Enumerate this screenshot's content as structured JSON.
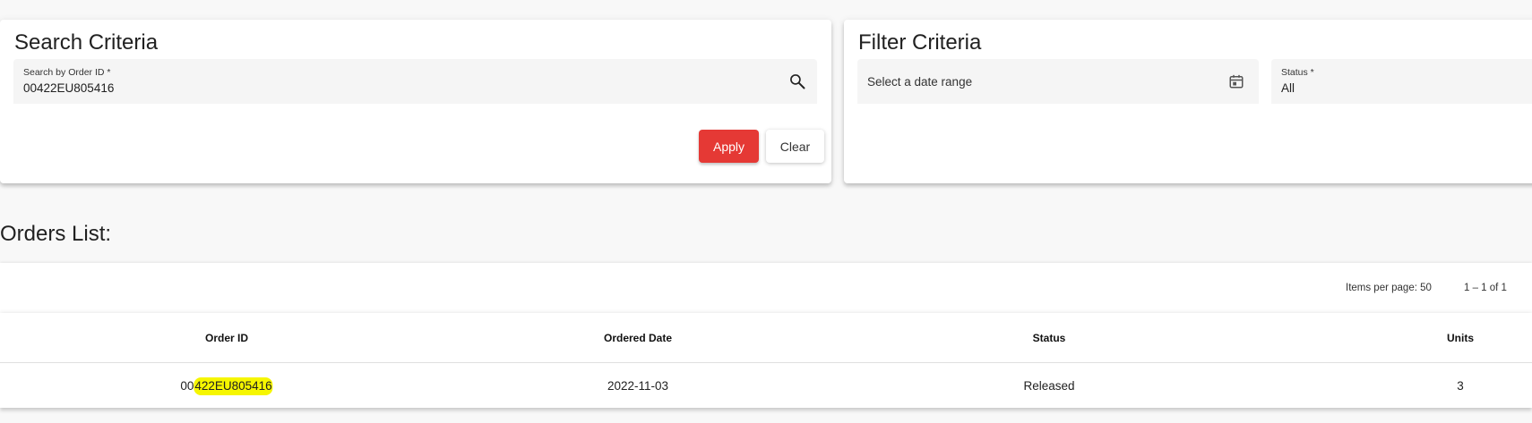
{
  "search": {
    "title": "Search Criteria",
    "field_label": "Search by Order ID *",
    "field_value": "00422EU805416",
    "apply_label": "Apply",
    "clear_label": "Clear",
    "search_icon": "search-icon"
  },
  "filter": {
    "title": "Filter Criteria",
    "date_placeholder": "Select a date range",
    "date_icon": "calendar-icon",
    "status_label": "Status *",
    "status_value": "All"
  },
  "orders": {
    "heading": "Orders List:",
    "paginator": {
      "items_per_page_label": "Items per page: 50",
      "range_label": "1 – 1 of 1"
    },
    "columns": [
      "Order ID",
      "Ordered Date",
      "Status",
      "Units"
    ],
    "rows": [
      {
        "order_id_prefix": "00",
        "order_id_highlight": "422EU805416",
        "ordered_date": "2022-11-03",
        "status": "Released",
        "units": "3"
      }
    ]
  },
  "colors": {
    "apply_button": "#e53935",
    "highlight": "#f6f600",
    "background": "#f8f8f8"
  }
}
